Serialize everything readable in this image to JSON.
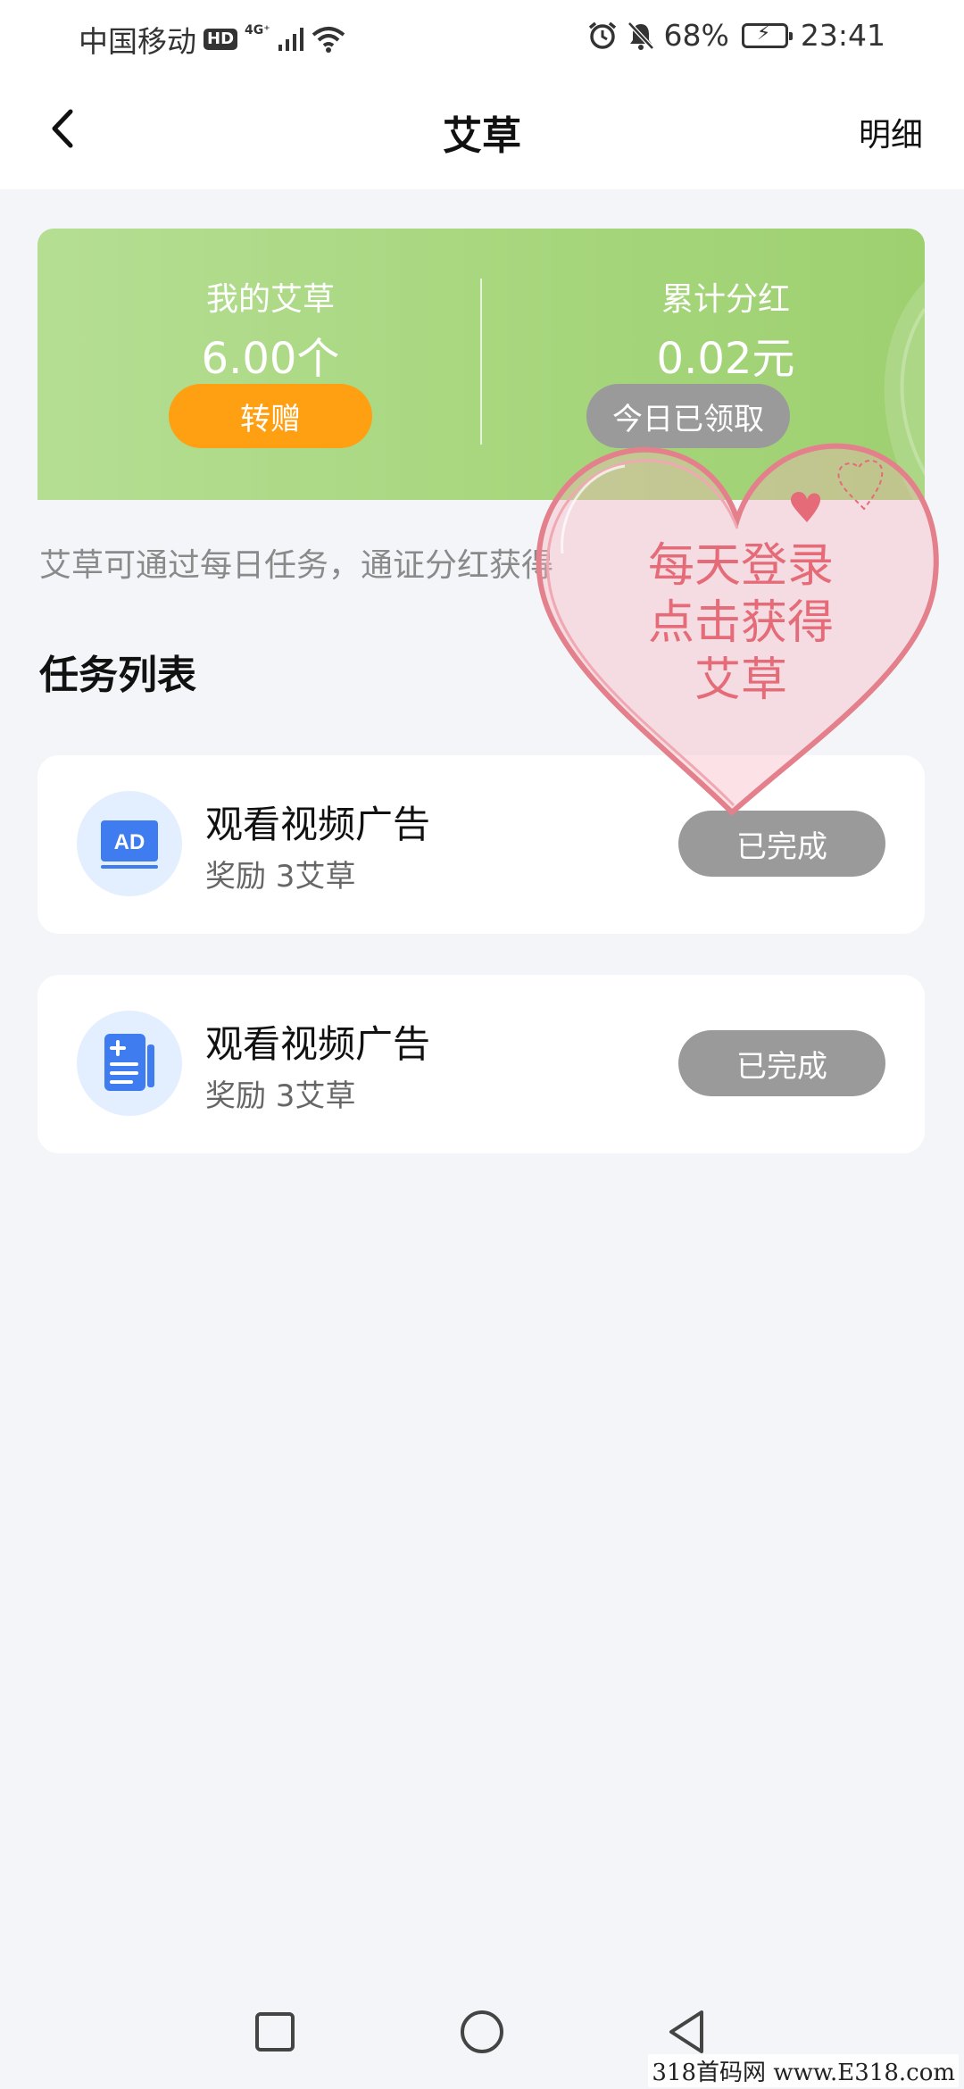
{
  "status_bar": {
    "carrier": "中国移动",
    "hd": "HD",
    "network": "4G⁺",
    "battery": "68%",
    "time": "23:41"
  },
  "header": {
    "title": "艾草",
    "detail_label": "明细"
  },
  "summary": {
    "my_label": "我的艾草",
    "my_value": "6.00个",
    "transfer_label": "转赠",
    "dividend_label": "累计分红",
    "dividend_value": "0.02元",
    "claimed_label": "今日已领取"
  },
  "hint": "艾草可通过每日任务，通证分红获得",
  "section_title": "任务列表",
  "tasks": [
    {
      "title": "观看视频广告",
      "reward": "奖励 3艾草",
      "status": "已完成",
      "icon": "ad-icon",
      "icon_text": "AD"
    },
    {
      "title": "观看视频广告",
      "reward": "奖励 3艾草",
      "status": "已完成",
      "icon": "note-add-icon"
    }
  ],
  "overlay": {
    "line1": "每天登录",
    "line2": "点击获得",
    "line3": "艾草"
  },
  "watermark": "318首码网 www.E318.com",
  "colors": {
    "green_start": "#b5de93",
    "green_end": "#9ed070",
    "orange_button": "#ff9f12",
    "gray_button": "#9a9a9a",
    "icon_blue": "#3f7cf0",
    "overlay_pink": "#e56b78"
  }
}
